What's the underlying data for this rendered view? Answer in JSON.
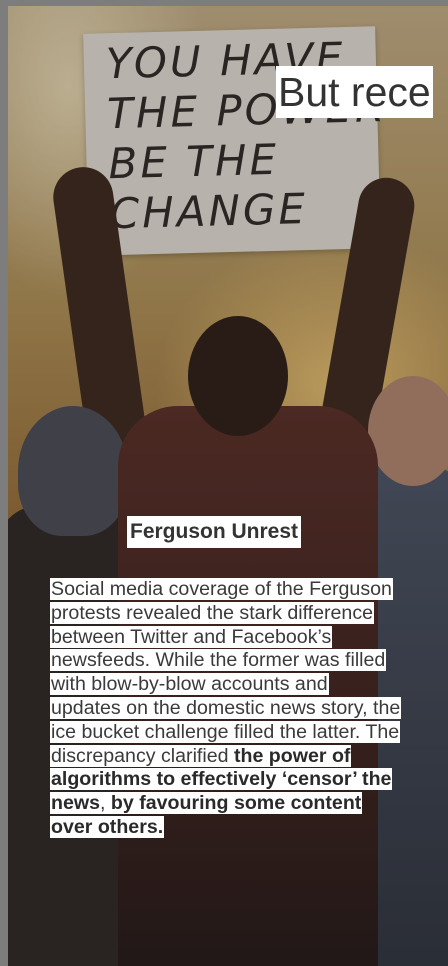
{
  "photo": {
    "sign_text": "YOU HAVE\nTHE POWER\nBE THE\nCHANGE"
  },
  "headline": "But rece",
  "card": {
    "title": "Ferguson Unrest",
    "body_plain": "Social media coverage of the Ferguson protests revealed the stark difference between Twitter and Facebook’s newsfeeds. While the former was filled with blow-by-blow accounts and updates on the domestic news story, the ice bucket challenge filled the latter. The discrepancy clarified ",
    "body_bold": "the power of algorithms to effectively ‘censor’ the news",
    "body_comma": ",",
    "body_bold_2": "by favouring some content over others."
  }
}
